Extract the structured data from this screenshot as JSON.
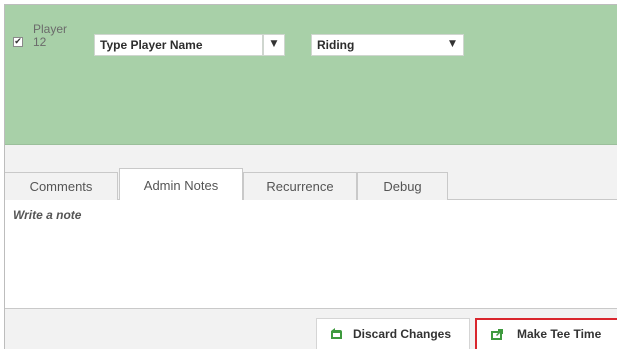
{
  "player": {
    "label_line1": "Player",
    "label_line2": "12",
    "checked_mark": "✔",
    "name_select": "Type Player Name",
    "cart_select": "Riding"
  },
  "tabs": [
    {
      "label": "Comments",
      "active": false
    },
    {
      "label": "Admin Notes",
      "active": true
    },
    {
      "label": "Recurrence",
      "active": false
    },
    {
      "label": "Debug",
      "active": false
    }
  ],
  "note": {
    "placeholder": "Write a note"
  },
  "buttons": {
    "discard": "Discard Changes",
    "make": "Make Tee Time"
  },
  "icons": {
    "discard": "undo-arrow-icon",
    "make": "share-out-icon",
    "dropdown": "triangle-down-icon"
  },
  "colors": {
    "panel_green": "#a8d0a8",
    "accent_red": "#d9262d",
    "icon_green": "#3e9a3e"
  }
}
